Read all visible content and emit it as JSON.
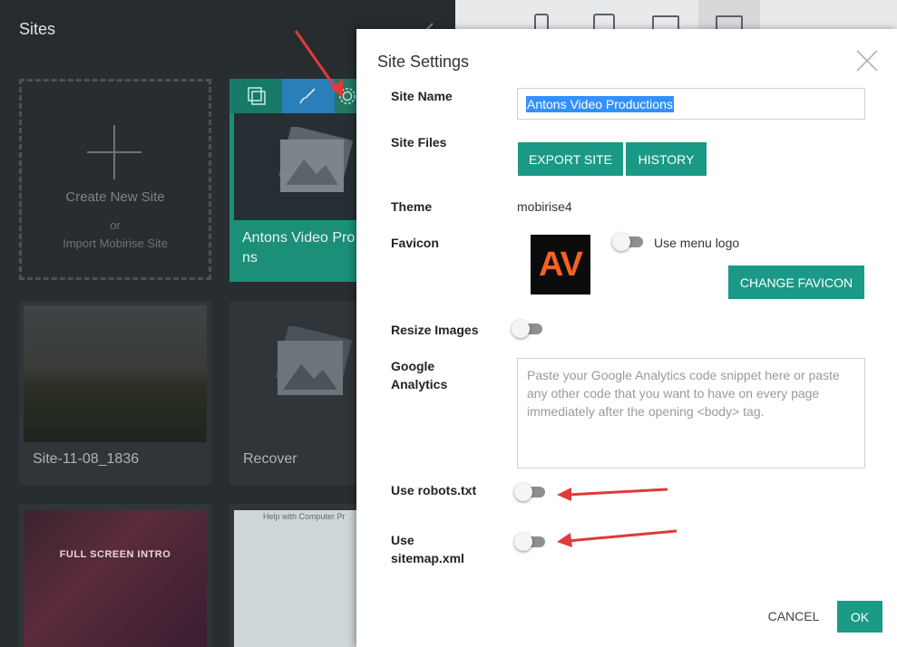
{
  "background": {
    "sites_title": "Sites",
    "create_card": {
      "title": "Create New Site",
      "or": "or",
      "import": "Import Mobirise Site"
    },
    "cards": [
      {
        "title": "Antons Video Pro",
        "title_wrap": "ns"
      },
      {
        "title": "Site-11-08_1836"
      },
      {
        "title": "Recover"
      }
    ],
    "intro_thumb_text": "FULL SCREEN INTRO",
    "help_thumb_text": "Help with Computer Pr"
  },
  "modal": {
    "title": "Site Settings",
    "site_name": {
      "label": "Site Name",
      "value": "Antons Video Productions"
    },
    "site_files": {
      "label": "Site Files",
      "export": "EXPORT SITE",
      "history": "HISTORY"
    },
    "theme": {
      "label": "Theme",
      "value": "mobirise4"
    },
    "favicon": {
      "label": "Favicon",
      "logo_text": "AV",
      "use_menu_logo": "Use menu logo",
      "change": "CHANGE FAVICON"
    },
    "resize_images": {
      "label": "Resize Images"
    },
    "google_analytics": {
      "label_line1": "Google",
      "label_line2": "Analytics",
      "placeholder": "Paste your Google Analytics code snippet here or paste any other code that you want to have on every page immediately after the opening <body> tag."
    },
    "robots": {
      "label": "Use robots.txt"
    },
    "sitemap": {
      "label_line1": "Use",
      "label_line2": "sitemap.xml"
    },
    "cancel": "CANCEL",
    "ok": "OK"
  },
  "colors": {
    "accent": "#1a9a86",
    "selection": "#3390ff",
    "arrow": "#e03a3a",
    "favicon_text": "#f26322"
  }
}
